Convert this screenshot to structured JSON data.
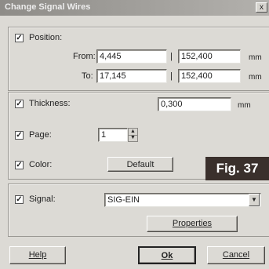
{
  "window": {
    "title": "Change Signal Wires",
    "close_glyph": "x"
  },
  "position": {
    "label": "Position:",
    "checked": true,
    "from_label": "From:",
    "from_x": "4,445",
    "from_y": "152,400",
    "to_label": "To:",
    "to_x": "17,145",
    "to_y": "152,400",
    "separator": "|",
    "unit": "mm"
  },
  "thickness": {
    "label": "Thickness:",
    "checked": true,
    "value": "0,300",
    "unit": "mm"
  },
  "page": {
    "label": "Page:",
    "checked": true,
    "value": "1"
  },
  "color": {
    "label": "Color:",
    "checked": true,
    "button_label": "Default"
  },
  "figure_label": "Fig. 37",
  "signal": {
    "label": "Signal:",
    "checked": true,
    "value": "SIG-EIN",
    "properties_label": "Properties"
  },
  "buttons": {
    "help": "Help",
    "ok": "Ok",
    "cancel": "Cancel"
  }
}
